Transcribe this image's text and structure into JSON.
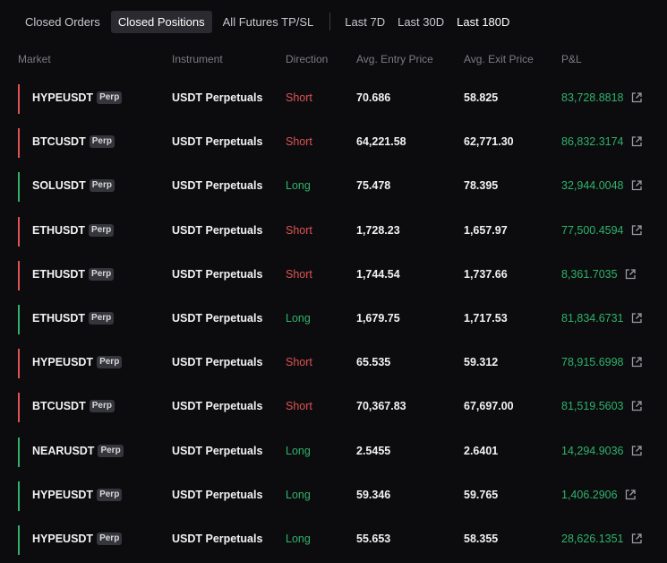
{
  "tabs": [
    {
      "label": "Closed Orders",
      "active": false
    },
    {
      "label": "Closed Positions",
      "active": true
    },
    {
      "label": "All Futures TP/SL",
      "active": false
    }
  ],
  "periods": [
    {
      "label": "Last 7D",
      "active": false
    },
    {
      "label": "Last 30D",
      "active": false
    },
    {
      "label": "Last 180D",
      "active": true
    }
  ],
  "columns": {
    "market": "Market",
    "instrument": "Instrument",
    "direction": "Direction",
    "entry": "Avg. Entry Price",
    "exit": "Avg. Exit Price",
    "pnl": "P&L"
  },
  "colors": {
    "short": "#e05353",
    "long": "#2fb26a",
    "active_tab_bg": "#2a2a30"
  },
  "rows": [
    {
      "market": "HYPEUSDT",
      "badge": "Perp",
      "instrument": "USDT Perpetuals",
      "direction": "Short",
      "entry": "70.686",
      "exit": "58.825",
      "pnl": "83,728.8818",
      "side": "short"
    },
    {
      "market": "BTCUSDT",
      "badge": "Perp",
      "instrument": "USDT Perpetuals",
      "direction": "Short",
      "entry": "64,221.58",
      "exit": "62,771.30",
      "pnl": "86,832.3174",
      "side": "short"
    },
    {
      "market": "SOLUSDT",
      "badge": "Perp",
      "instrument": "USDT Perpetuals",
      "direction": "Long",
      "entry": "75.478",
      "exit": "78.395",
      "pnl": "32,944.0048",
      "side": "long"
    },
    {
      "market": "ETHUSDT",
      "badge": "Perp",
      "instrument": "USDT Perpetuals",
      "direction": "Short",
      "entry": "1,728.23",
      "exit": "1,657.97",
      "pnl": "77,500.4594",
      "side": "short"
    },
    {
      "market": "ETHUSDT",
      "badge": "Perp",
      "instrument": "USDT Perpetuals",
      "direction": "Short",
      "entry": "1,744.54",
      "exit": "1,737.66",
      "pnl": "8,361.7035",
      "side": "short"
    },
    {
      "market": "ETHUSDT",
      "badge": "Perp",
      "instrument": "USDT Perpetuals",
      "direction": "Long",
      "entry": "1,679.75",
      "exit": "1,717.53",
      "pnl": "81,834.6731",
      "side": "long"
    },
    {
      "market": "HYPEUSDT",
      "badge": "Perp",
      "instrument": "USDT Perpetuals",
      "direction": "Short",
      "entry": "65.535",
      "exit": "59.312",
      "pnl": "78,915.6998",
      "side": "short"
    },
    {
      "market": "BTCUSDT",
      "badge": "Perp",
      "instrument": "USDT Perpetuals",
      "direction": "Short",
      "entry": "70,367.83",
      "exit": "67,697.00",
      "pnl": "81,519.5603",
      "side": "short"
    },
    {
      "market": "NEARUSDT",
      "badge": "Perp",
      "instrument": "USDT Perpetuals",
      "direction": "Long",
      "entry": "2.5455",
      "exit": "2.6401",
      "pnl": "14,294.9036",
      "side": "long"
    },
    {
      "market": "HYPEUSDT",
      "badge": "Perp",
      "instrument": "USDT Perpetuals",
      "direction": "Long",
      "entry": "59.346",
      "exit": "59.765",
      "pnl": "1,406.2906",
      "side": "long"
    },
    {
      "market": "HYPEUSDT",
      "badge": "Perp",
      "instrument": "USDT Perpetuals",
      "direction": "Long",
      "entry": "55.653",
      "exit": "58.355",
      "pnl": "28,626.1351",
      "side": "long"
    }
  ]
}
